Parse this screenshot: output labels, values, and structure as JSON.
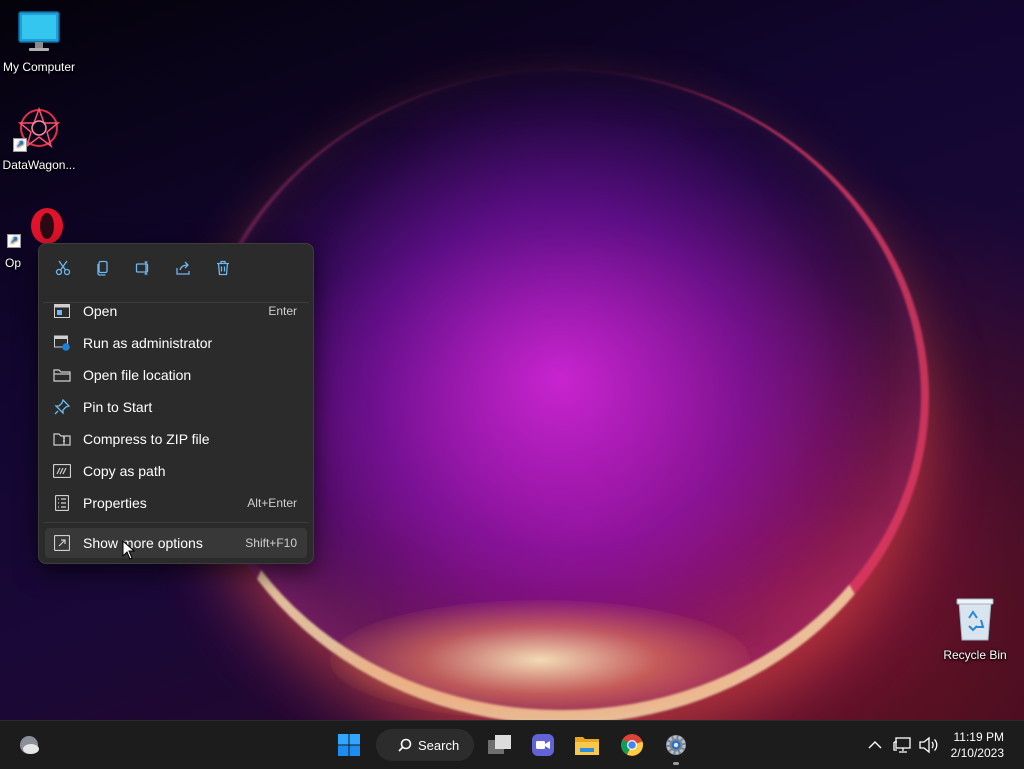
{
  "desktop": {
    "icons": [
      {
        "label": "My Computer",
        "icon": "monitor-icon"
      },
      {
        "label": "DataWagon...",
        "icon": "datawagon-icon"
      },
      {
        "label": "Op",
        "icon": "opera-icon"
      },
      {
        "label": "Recycle Bin",
        "icon": "recycle-bin-icon"
      }
    ]
  },
  "context_menu": {
    "quick_actions": [
      "cut-icon",
      "copy-icon",
      "rename-icon",
      "share-icon",
      "delete-icon"
    ],
    "items": [
      {
        "label": "Open",
        "shortcut": "Enter",
        "icon": "open-window-icon"
      },
      {
        "label": "Run as administrator",
        "shortcut": "",
        "icon": "admin-shield-icon"
      },
      {
        "label": "Open file location",
        "shortcut": "",
        "icon": "folder-icon"
      },
      {
        "label": "Pin to Start",
        "shortcut": "",
        "icon": "pin-icon"
      },
      {
        "label": "Compress to ZIP file",
        "shortcut": "",
        "icon": "zip-icon"
      },
      {
        "label": "Copy as path",
        "shortcut": "",
        "icon": "path-icon"
      },
      {
        "label": "Properties",
        "shortcut": "Alt+Enter",
        "icon": "properties-icon"
      },
      {
        "label": "Show more options",
        "shortcut": "Shift+F10",
        "icon": "more-options-icon"
      }
    ]
  },
  "taskbar": {
    "search_label": "Search",
    "apps": [
      "start-icon",
      "task-view-icon",
      "teams-icon",
      "file-explorer-icon",
      "chrome-icon",
      "settings-icon"
    ],
    "tray": {
      "time": "11:19 PM",
      "date": "2/10/2023"
    }
  },
  "colors": {
    "menu_bg": "#2b2b2b",
    "taskbar_bg": "#1c1c1c",
    "accent": "#0078d4"
  }
}
